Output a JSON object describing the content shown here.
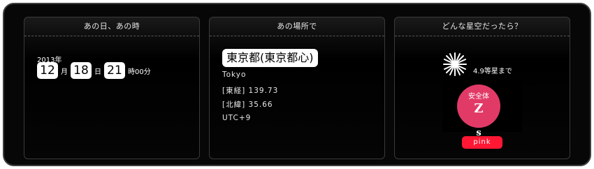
{
  "panels": {
    "when": {
      "title": "あの日、あの時",
      "year": "2013年",
      "month": "12",
      "month_unit": "月",
      "day": "18",
      "day_unit": "日",
      "hour": "21",
      "time_suffix": "時00分"
    },
    "where": {
      "title": "あの場所で",
      "location": "東京都(東京都心)",
      "city": "Tokyo",
      "longitude": "[東経] 139.73",
      "latitude": "[北緯] 35.66",
      "timezone": "UTC+9"
    },
    "sky": {
      "title": "どんな星空だったら？",
      "magnitude": "4.9等星まで",
      "circle_top": "安全体",
      "circle_mid": "Z",
      "circle_bottom": "s",
      "pink_label": "pink"
    }
  },
  "colors": {
    "pink_circle": "#e13a67",
    "pink_button": "#ff1733"
  },
  "icons": {
    "star": "star-burst-icon"
  }
}
